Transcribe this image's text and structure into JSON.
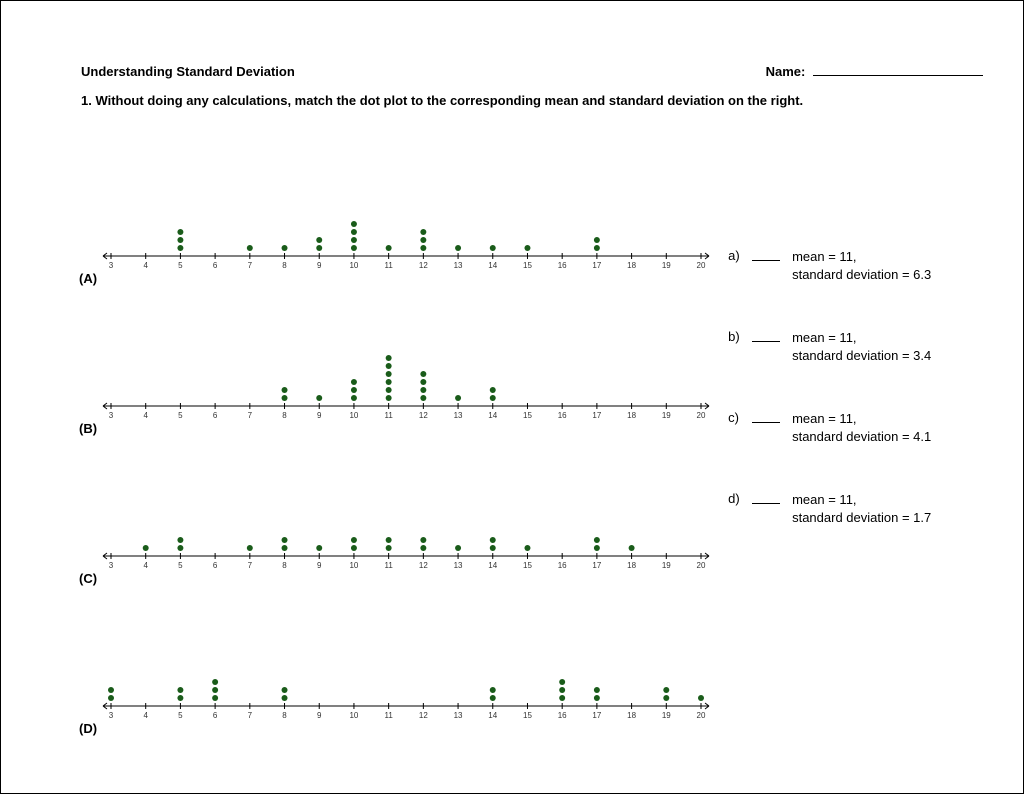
{
  "title": "Understanding Standard Deviation",
  "name_label": "Name:",
  "question": "1. Without doing any calculations, match the dot plot to the corresponding mean and standard deviation on the right.",
  "axis": {
    "min": 3,
    "max": 20
  },
  "chart_data": [
    {
      "label": "(A)",
      "type": "dotplot",
      "points": {
        "5": 3,
        "7": 1,
        "8": 1,
        "9": 2,
        "10": 4,
        "11": 1,
        "12": 3,
        "13": 1,
        "14": 1,
        "15": 1,
        "17": 2
      }
    },
    {
      "label": "(B)",
      "type": "dotplot",
      "points": {
        "8": 2,
        "9": 1,
        "10": 3,
        "11": 6,
        "12": 4,
        "13": 1,
        "14": 2
      }
    },
    {
      "label": "(C)",
      "type": "dotplot",
      "points": {
        "4": 1,
        "5": 2,
        "7": 1,
        "8": 2,
        "9": 1,
        "10": 2,
        "11": 2,
        "12": 2,
        "13": 1,
        "14": 2,
        "15": 1,
        "17": 2,
        "18": 1
      }
    },
    {
      "label": "(D)",
      "type": "dotplot",
      "points": {
        "3": 2,
        "5": 2,
        "6": 3,
        "8": 2,
        "14": 2,
        "16": 3,
        "17": 2,
        "19": 2,
        "20": 1
      }
    }
  ],
  "options": [
    {
      "key": "a)",
      "line1": "mean = 11,",
      "line2": "standard deviation = 6.3"
    },
    {
      "key": "b)",
      "line1": "mean = 11,",
      "line2": "standard deviation = 3.4"
    },
    {
      "key": "c)",
      "line1": "mean = 11,",
      "line2": "standard deviation = 4.1"
    },
    {
      "key": "d)",
      "line1": "mean = 11,",
      "line2": "standard deviation = 1.7"
    }
  ]
}
